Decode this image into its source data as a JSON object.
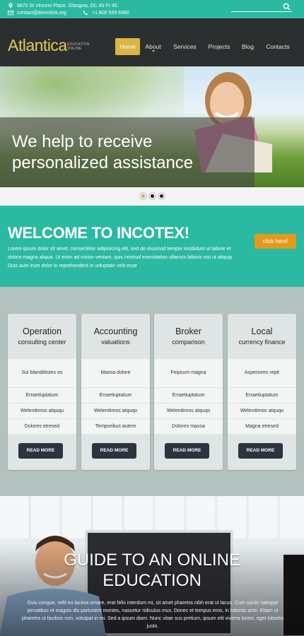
{
  "topbar": {
    "address": "9870 St Vincent Place, Glasgow, DC 45 Fr 45.",
    "email": "contact@demolink.org",
    "phone": "+1 800 559 6580"
  },
  "header": {
    "logo": "Atlantica",
    "logo_sub_line1": "EDUCATION",
    "logo_sub_line2": "ONLINE",
    "nav": [
      {
        "label": "Home"
      },
      {
        "label": "About"
      },
      {
        "label": "Services"
      },
      {
        "label": "Projects"
      },
      {
        "label": "Blog"
      },
      {
        "label": "Contacts"
      }
    ]
  },
  "hero": {
    "line1": "We help to receive",
    "line2": "personalized assistance",
    "slide_count": 3,
    "active_slide": 1
  },
  "welcome": {
    "title": "WELCOME TO INCOTEX!",
    "text": "Lorem ipsum dolor sit amet, consectetur adipisicing elit, sed do eiusmod tempor incididunt ut labore et dolore magna aliqua. Ut enim ad minim veniam, quis nostrud exercitation ullamco laboris nisi ut aliquip Duis aute irure dolor in reprehenderit in voluptate velit esse",
    "cta": "click here!"
  },
  "services": {
    "button_label": "READ MORE",
    "cards": [
      {
        "title": "Operation",
        "subtitle": "consulting center",
        "items": [
          "Sui blanditiistes es",
          "Erraetiuptatum",
          "Welenitimos atququ",
          "Dolores etresed"
        ]
      },
      {
        "title": "Accounting",
        "subtitle": "valuations",
        "items": [
          "Massa dolore",
          "Erraetiuptatum",
          "Welenitimos atquqo",
          "Temporibus autem"
        ]
      },
      {
        "title": "Broker",
        "subtitle": "comparison",
        "items": [
          "Feipsum magna",
          "Erraetiuptatum",
          "Welenitimos atquqo",
          "Dolores massa"
        ]
      },
      {
        "title": "Local",
        "subtitle": "currency finance",
        "items": [
          "Asperiores repit",
          "Erraetiuptatum",
          "Welenitimos atquqo",
          "Magna etresed"
        ]
      }
    ]
  },
  "guide": {
    "line1": "GUIDE TO AN ONLINE",
    "line2": "EDUCATION",
    "text": "Duis congue, velit eu lacinia ornare, erat felis interdum mi, sit amet pharetra nibh erat ut lacus. Cum sociis natoque penatibus et magnis dis parturient montes, nascetur ridiculus mus. Donec et tempus eros, in lobortis ante. Etiam ut pharetra ut facilisis non, volutpat in mi. Sed a ipsum diam. Nunc vitae sus pretium, ipsum elit viverra lorem, eget lobortis justo."
  },
  "colors": {
    "teal": "#2bb9a1",
    "gold": "#d9b543",
    "orange": "#e09a1e",
    "dark": "#2c2f30"
  }
}
